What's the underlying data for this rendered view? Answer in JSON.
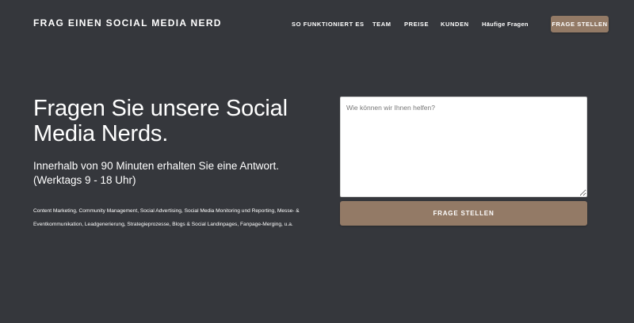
{
  "header": {
    "brand": "FRAG EINEN SOCIAL MEDIA NERD",
    "nav": {
      "how_it_works": "SO FUNKTIONIERT ES",
      "team": "TEAM",
      "prices": "PREISE",
      "customers": "KUNDEN",
      "faq": "Häufige Fragen",
      "cta": "FRAGE STELLEN"
    }
  },
  "hero": {
    "title": "Fragen Sie unsere Social Media Nerds.",
    "subtitle": "Innerhalb von 90 Minuten erhalten Sie eine Antwort. (Werktags 9 - 18 Uhr)",
    "tags": "Content Marketing, Community Management, Social Advertising, Social Media Monitoring und Reporting, Messe- & Eventkommunikation, Leadgenerierung, Strategieprozesse, Blogs & Social Landinpages, Fanpage-Merging, u.a."
  },
  "form": {
    "question_placeholder": "Wie können wir Ihnen helfen?",
    "question_value": "",
    "submit_label": "FRAGE STELLEN"
  },
  "colors": {
    "background": "#35373c",
    "accent": "#937a66",
    "text": "#ffffff"
  }
}
